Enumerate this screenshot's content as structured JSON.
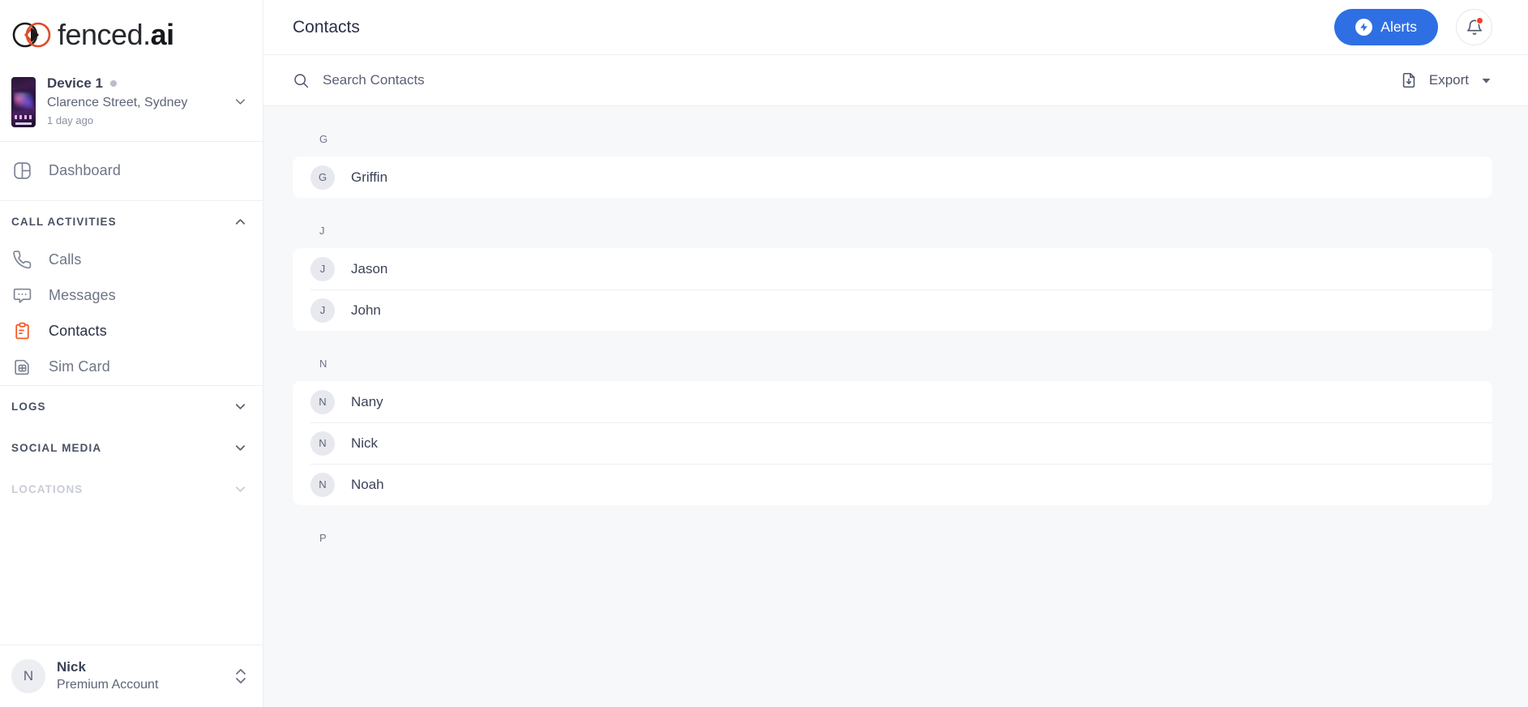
{
  "brand": {
    "name_light": "fenced",
    "name_dot": ".",
    "name_bold": "ai",
    "mark_color_left": "#1b1b1b",
    "mark_color_right": "#e04a28"
  },
  "sidebar": {
    "device": {
      "name": "Device 1",
      "location": "Clarence Street, Sydney",
      "last_seen": "1 day ago",
      "status_dot_color": "#b8bdc9"
    },
    "primary": [
      {
        "label": "Dashboard",
        "icon": "dashboard-icon",
        "active": false
      }
    ],
    "sections": [
      {
        "title": "CALL ACTIVITIES",
        "expanded": true,
        "muted": false,
        "items": [
          {
            "label": "Calls",
            "icon": "phone-icon",
            "active": false
          },
          {
            "label": "Messages",
            "icon": "message-icon",
            "active": false
          },
          {
            "label": "Contacts",
            "icon": "contacts-clipboard-icon",
            "active": true
          },
          {
            "label": "Sim Card",
            "icon": "sim-card-icon",
            "active": false
          }
        ]
      },
      {
        "title": "LOGS",
        "expanded": false,
        "muted": false,
        "items": []
      },
      {
        "title": "SOCIAL MEDIA",
        "expanded": false,
        "muted": false,
        "items": []
      },
      {
        "title": "LOCATIONS",
        "expanded": false,
        "muted": true,
        "items": []
      }
    ],
    "user": {
      "initial": "N",
      "name": "Nick",
      "plan": "Premium Account"
    }
  },
  "header": {
    "title": "Contacts",
    "alerts_label": "Alerts",
    "alerts_color": "#2f6fe4",
    "notification_badge_color": "#f0402a"
  },
  "toolbar": {
    "search_placeholder": "Search Contacts",
    "search_value": "",
    "export_label": "Export"
  },
  "contacts": {
    "groups": [
      {
        "letter": "G",
        "items": [
          {
            "initial": "G",
            "name": "Griffin"
          }
        ]
      },
      {
        "letter": "J",
        "items": [
          {
            "initial": "J",
            "name": "Jason"
          },
          {
            "initial": "J",
            "name": "John"
          }
        ]
      },
      {
        "letter": "N",
        "items": [
          {
            "initial": "N",
            "name": "Nany"
          },
          {
            "initial": "N",
            "name": "Nick"
          },
          {
            "initial": "N",
            "name": "Noah"
          }
        ]
      },
      {
        "letter": "P",
        "items": []
      }
    ]
  }
}
